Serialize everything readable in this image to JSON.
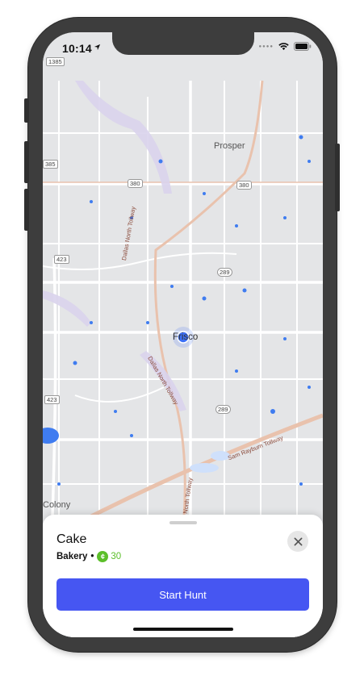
{
  "status_bar": {
    "time": "10:14",
    "location_icon": "location-arrow-icon",
    "signal_icon": "cellular-dots-icon",
    "wifi_icon": "wifi-icon",
    "battery_icon": "battery-icon"
  },
  "map": {
    "labels": {
      "prosper": "Prosper",
      "frisco": "Frisco",
      "colony": "Colony",
      "dallas_north_tollway_1": "Dallas North Tollway",
      "dallas_north_tollway_2": "Dallas North Tollway",
      "dallas_north_tollway_3": "North Tollway",
      "sam_rayburn": "Sam Rayburn Tollway"
    },
    "shields": {
      "s1385": "1385",
      "s385": "385",
      "s380a": "380",
      "s380b": "380",
      "s289a": "289",
      "s289b": "289",
      "s423a": "423",
      "s423b": "423"
    },
    "colors": {
      "land": "#e4e5e7",
      "road": "#ffffff",
      "water": "#3f7cf0",
      "tollway": "#e9c2ad",
      "user_dot": "#3b6ff5"
    }
  },
  "sheet": {
    "title": "Cake",
    "category": "Bakery",
    "separator": "•",
    "coin_symbol": "¢",
    "coin_value": "30",
    "close_icon": "close-x-icon",
    "start_label": "Start Hunt"
  },
  "colors": {
    "accent": "#4656f2",
    "coin": "#5cbf2a"
  }
}
